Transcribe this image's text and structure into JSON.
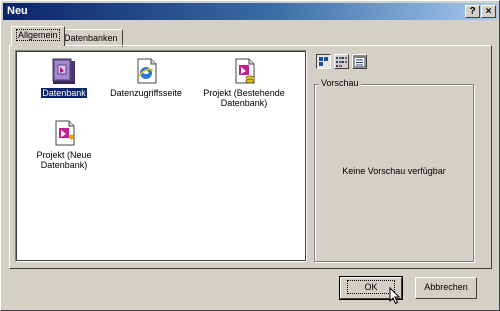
{
  "window": {
    "title": "Neu",
    "help_label": "?",
    "close_label": "×"
  },
  "tabs": [
    {
      "label": "Allgemein",
      "active": true
    },
    {
      "label": "Datenbanken",
      "active": false
    }
  ],
  "templates": [
    {
      "label": "Datenbank",
      "icon": "database-template-icon",
      "selected": true
    },
    {
      "label": "Datenzugriffsseite",
      "icon": "data-access-page-icon",
      "selected": false
    },
    {
      "label": "Projekt (Bestehende Datenbank)",
      "icon": "project-existing-db-icon",
      "selected": false
    },
    {
      "label": "Projekt (Neue Datenbank)",
      "icon": "project-new-db-icon",
      "selected": false
    }
  ],
  "view_buttons": [
    {
      "icon": "large-icons-view-icon",
      "pressed": true
    },
    {
      "icon": "list-view-icon",
      "pressed": false
    },
    {
      "icon": "details-view-icon",
      "pressed": false
    }
  ],
  "preview": {
    "title": "Vorschau",
    "message": "Keine Vorschau verfügbar"
  },
  "buttons": {
    "ok_label": "OK",
    "cancel_label": "Abbrechen"
  },
  "colors": {
    "title_gradient_start": "#0a246a",
    "title_gradient_end": "#a6caf0",
    "face": "#d4d0c8",
    "selection": "#0a246a"
  }
}
